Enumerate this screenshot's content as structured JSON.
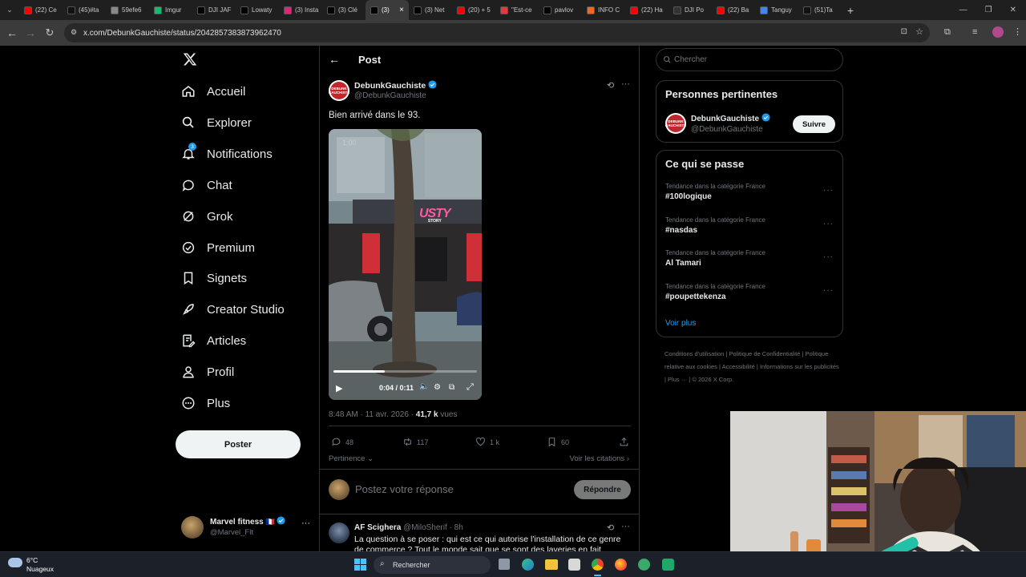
{
  "browser": {
    "tabs": [
      {
        "label": "(22) Ce",
        "icon": "youtube-icon",
        "color": "#ff0000"
      },
      {
        "label": "(45)#ta",
        "icon": "tiktok-icon",
        "color": "#111111"
      },
      {
        "label": "59efe6",
        "icon": "globe-icon",
        "color": "#888888"
      },
      {
        "label": "Imgur",
        "icon": "imgur-icon",
        "color": "#1bb76e"
      },
      {
        "label": "DJI JAF",
        "icon": "x-icon",
        "color": "#000000"
      },
      {
        "label": "Lowaty",
        "icon": "x-icon",
        "color": "#000000"
      },
      {
        "label": "(3) Insta",
        "icon": "instagram-icon",
        "color": "#d62976"
      },
      {
        "label": "(3) Clé",
        "icon": "x-icon",
        "color": "#000000"
      },
      {
        "label": "(3)",
        "icon": "x-icon",
        "color": "#000000"
      },
      {
        "label": "(3) Net",
        "icon": "x-icon",
        "color": "#000000"
      },
      {
        "label": "(20) + 5",
        "icon": "youtube-icon",
        "color": "#ff0000"
      },
      {
        "label": "\"Est-ce",
        "icon": "e-icon",
        "color": "#e03a3a"
      },
      {
        "label": "pavlov",
        "icon": "x-icon",
        "color": "#000000"
      },
      {
        "label": "INFO C",
        "icon": "rss-icon",
        "color": "#f26522"
      },
      {
        "label": "(22) Ha",
        "icon": "youtube-icon",
        "color": "#ff0000"
      },
      {
        "label": "DJI Po",
        "icon": "dji-icon",
        "color": "#333333"
      },
      {
        "label": "(22) Ba",
        "icon": "youtube-icon",
        "color": "#ff0000"
      },
      {
        "label": "Tanguy",
        "icon": "google-icon",
        "color": "#4285f4"
      },
      {
        "label": "(51)Ta",
        "icon": "tiktok-icon",
        "color": "#111111"
      }
    ],
    "active_tab_index": 8,
    "url": "x.com/DebunkGauchiste/status/2042857383873962470"
  },
  "sidebar": {
    "items": [
      {
        "label": "Accueil",
        "icon": "home-icon"
      },
      {
        "label": "Explorer",
        "icon": "search-icon"
      },
      {
        "label": "Notifications",
        "icon": "bell-icon",
        "badge": "3"
      },
      {
        "label": "Chat",
        "icon": "chat-icon"
      },
      {
        "label": "Grok",
        "icon": "grok-icon"
      },
      {
        "label": "Premium",
        "icon": "premium-icon"
      },
      {
        "label": "Signets",
        "icon": "bookmark-icon"
      },
      {
        "label": "Creator Studio",
        "icon": "rocket-icon"
      },
      {
        "label": "Articles",
        "icon": "article-icon"
      },
      {
        "label": "Profil",
        "icon": "person-icon"
      },
      {
        "label": "Plus",
        "icon": "more-circle-icon"
      }
    ],
    "post_button": "Poster",
    "account": {
      "name": "Marvel fitness",
      "flag": "🇫🇷",
      "handle": "@Marvel_Flt"
    }
  },
  "post": {
    "header_title": "Post",
    "author_name": "DebunkGauchiste",
    "author_handle": "@DebunkGauchiste",
    "avatar_text": "DEBUNK GAUCHISTE",
    "text": "Bien arrivé dans le 93.",
    "video": {
      "time": "0:04 / 0:11",
      "progress": 0.36,
      "overlay_time": "1:00",
      "sign": "USTY",
      "sign_sub": "STORY"
    },
    "timestamp": "8:48 AM · 11 avr. 2026 · ",
    "views_count": "41,7 k",
    "views_label": " vues",
    "stats": {
      "replies": "48",
      "reposts": "117",
      "likes": "1 k",
      "bookmarks": "60"
    },
    "sort_label": "Pertinence",
    "quotes_label": "Voir les citations",
    "reply_placeholder": "Postez votre réponse",
    "reply_button": "Répondre"
  },
  "reply": {
    "name": "AF Scighera",
    "handle": "@MiloSherif",
    "time": "· 8h",
    "text": "La question à se poser : qui est ce qui autorise l'installation de ce genre de commerce ? Tout le monde sait que se sont des laveries en fait"
  },
  "right": {
    "search_placeholder": "Chercher",
    "relevant_title": "Personnes pertinentes",
    "relevant_person": {
      "name": "DebunkGauchiste",
      "handle": "@DebunkGauchiste",
      "follow": "Suivre"
    },
    "trends_title": "Ce qui se passe",
    "trends": [
      {
        "category": "Tendance dans la catégorie France",
        "name": "#100logique"
      },
      {
        "category": "Tendance dans la catégorie France",
        "name": "#nasdas"
      },
      {
        "category": "Tendance dans la catégorie France",
        "name": "Al Tamari"
      },
      {
        "category": "Tendance dans la catégorie France",
        "name": "#poupettekenza"
      }
    ],
    "see_more": "Voir plus",
    "footer": [
      "Conditions d'utilisation",
      "Politique de Confidentialité",
      "Politique relative aux cookies",
      "Accessibilité",
      "Informations sur les publicités",
      "Plus ···",
      "© 2026 X Corp."
    ]
  },
  "taskbar": {
    "weather_temp": "6°C",
    "weather_desc": "Nuageux",
    "search_label": "Rechercher"
  },
  "colors": {
    "accent": "#1d9bf0",
    "background": "#000000",
    "border": "#2f3336",
    "muted": "#71767b"
  }
}
